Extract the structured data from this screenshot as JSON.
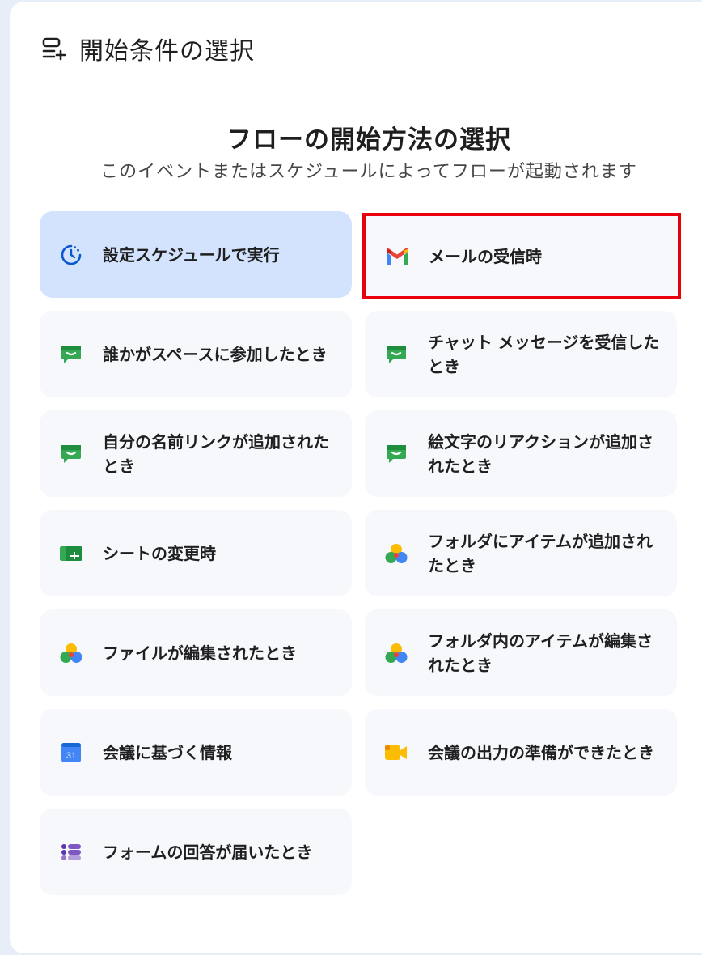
{
  "header": {
    "title": "開始条件の選択",
    "icon": "add-list-icon"
  },
  "hero": {
    "title": "フローの開始方法の選択",
    "subtitle": "このイベントまたはスケジュールによってフローが起動されます"
  },
  "colors": {
    "selected_bg": "#d3e3fd",
    "card_bg": "#f6f8fc",
    "highlight_border": "#e8000b"
  },
  "triggers": [
    {
      "label": "設定スケジュールで実行",
      "icon": "schedule-icon",
      "state": "selected"
    },
    {
      "label": "メールの受信時",
      "icon": "gmail-icon",
      "state": "highlighted"
    },
    {
      "label": "誰かがスペースに参加したとき",
      "icon": "chat-icon",
      "state": "default"
    },
    {
      "label": "チャット メッセージを受信したとき",
      "icon": "chat-icon",
      "state": "default"
    },
    {
      "label": "自分の名前リンクが追加されたとき",
      "icon": "chat-icon",
      "state": "default"
    },
    {
      "label": "絵文字のリアクションが追加されたとき",
      "icon": "chat-icon",
      "state": "default"
    },
    {
      "label": "シートの変更時",
      "icon": "sheets-icon",
      "state": "default"
    },
    {
      "label": "フォルダにアイテムが追加されたとき",
      "icon": "drive-icon",
      "state": "default"
    },
    {
      "label": "ファイルが編集されたとき",
      "icon": "drive-icon",
      "state": "default"
    },
    {
      "label": "フォルダ内のアイテムが編集されたとき",
      "icon": "drive-icon",
      "state": "default"
    },
    {
      "label": "会議に基づく情報",
      "icon": "calendar-icon",
      "state": "default"
    },
    {
      "label": "会議の出力の準備ができたとき",
      "icon": "meet-icon",
      "state": "default"
    },
    {
      "label": "フォームの回答が届いたとき",
      "icon": "forms-icon",
      "state": "default"
    }
  ]
}
